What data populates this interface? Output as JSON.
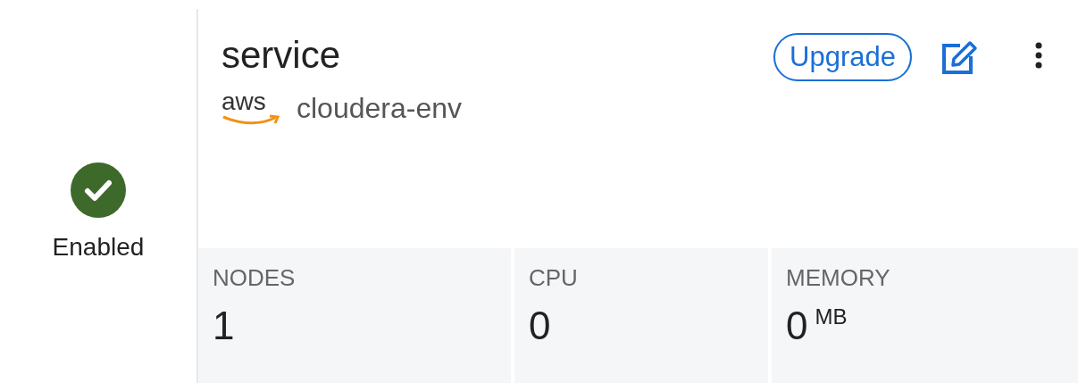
{
  "status": {
    "label": "Enabled"
  },
  "service": {
    "name": "service",
    "provider": "aws",
    "environment": "cloudera-env"
  },
  "actions": {
    "upgrade": "Upgrade"
  },
  "metrics": [
    {
      "label": "NODES",
      "value": "1"
    },
    {
      "label": "CPU",
      "value": "0"
    },
    {
      "label": "MEMORY",
      "value": "0",
      "unit": "MB"
    }
  ]
}
